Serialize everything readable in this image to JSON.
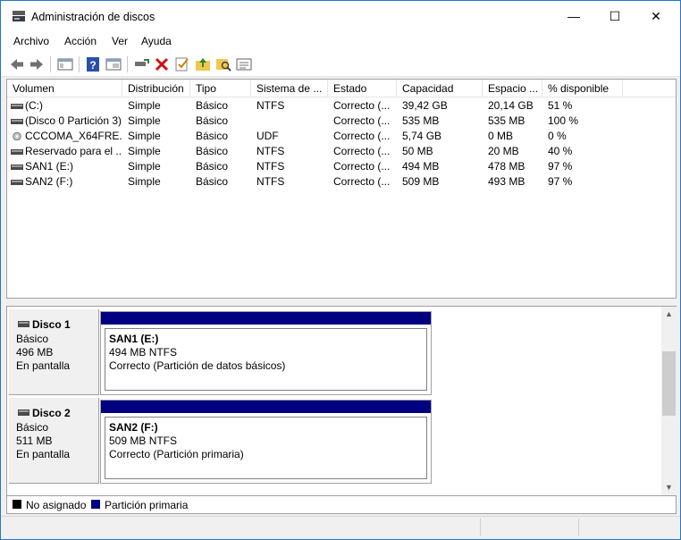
{
  "window": {
    "title": "Administración de discos"
  },
  "titlebar": {
    "minimize": "—",
    "maximize": "☐",
    "close": "✕"
  },
  "menu": [
    "Archivo",
    "Acción",
    "Ver",
    "Ayuda"
  ],
  "toolbar_icons": [
    "back-icon",
    "forward-icon",
    "console-tree-icon",
    "help-icon",
    "properties-icon",
    "connect-icon",
    "delete-icon",
    "check-icon",
    "folder-up-icon",
    "search-folder-icon",
    "list-view-icon"
  ],
  "columns": [
    "Volumen",
    "Distribución",
    "Tipo",
    "Sistema de ...",
    "Estado",
    "Capacidad",
    "Espacio ...",
    "% disponible"
  ],
  "volumes": [
    {
      "icon": "drive-icon",
      "name": "(C:)",
      "layout": "Simple",
      "type": "Básico",
      "fs": "NTFS",
      "status": "Correcto (...",
      "capacity": "39,42 GB",
      "free": "20,14 GB",
      "pct": "51 %"
    },
    {
      "icon": "drive-icon",
      "name": "(Disco 0 Partición 3)",
      "layout": "Simple",
      "type": "Básico",
      "fs": "",
      "status": "Correcto (...",
      "capacity": "535 MB",
      "free": "535 MB",
      "pct": "100 %"
    },
    {
      "icon": "cd-icon",
      "name": "CCCOMA_X64FRE...",
      "layout": "Simple",
      "type": "Básico",
      "fs": "UDF",
      "status": "Correcto (...",
      "capacity": "5,74 GB",
      "free": "0 MB",
      "pct": "0 %"
    },
    {
      "icon": "drive-icon",
      "name": "Reservado para el ...",
      "layout": "Simple",
      "type": "Básico",
      "fs": "NTFS",
      "status": "Correcto (...",
      "capacity": "50 MB",
      "free": "20 MB",
      "pct": "40 %"
    },
    {
      "icon": "drive-icon",
      "name": "SAN1 (E:)",
      "layout": "Simple",
      "type": "Básico",
      "fs": "NTFS",
      "status": "Correcto (...",
      "capacity": "494 MB",
      "free": "478 MB",
      "pct": "97 %"
    },
    {
      "icon": "drive-icon",
      "name": "SAN2 (F:)",
      "layout": "Simple",
      "type": "Básico",
      "fs": "NTFS",
      "status": "Correcto (...",
      "capacity": "509 MB",
      "free": "493 MB",
      "pct": "97 %"
    }
  ],
  "disks": [
    {
      "name": "Disco 1",
      "type": "Básico",
      "size": "496 MB",
      "state": "En pantalla",
      "partition": {
        "label": "SAN1  (E:)",
        "size_fs": "494 MB NTFS",
        "status": "Correcto (Partición de datos básicos)"
      }
    },
    {
      "name": "Disco 2",
      "type": "Básico",
      "size": "511 MB",
      "state": "En pantalla",
      "partition": {
        "label": "SAN2  (F:)",
        "size_fs": "509 MB NTFS",
        "status": "Correcto (Partición primaria)"
      }
    }
  ],
  "legend": [
    {
      "label": "No asignado",
      "color": "#000000"
    },
    {
      "label": "Partición primaria",
      "color": "#000080"
    }
  ],
  "colors": {
    "partition_bar": "#000080",
    "window_border": "#1f78c8"
  }
}
